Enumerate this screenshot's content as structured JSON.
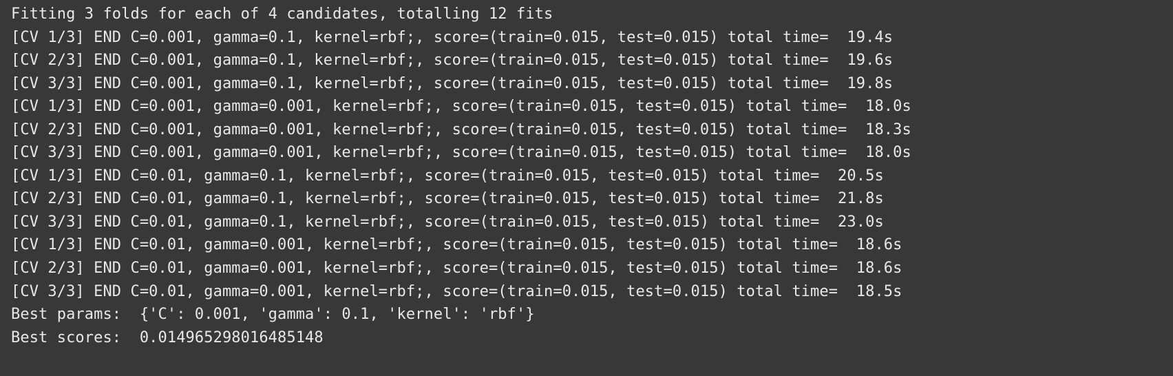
{
  "console": {
    "lines": [
      "Fitting 3 folds for each of 4 candidates, totalling 12 fits",
      "[CV 1/3] END C=0.001, gamma=0.1, kernel=rbf;, score=(train=0.015, test=0.015) total time=  19.4s",
      "[CV 2/3] END C=0.001, gamma=0.1, kernel=rbf;, score=(train=0.015, test=0.015) total time=  19.6s",
      "[CV 3/3] END C=0.001, gamma=0.1, kernel=rbf;, score=(train=0.015, test=0.015) total time=  19.8s",
      "[CV 1/3] END C=0.001, gamma=0.001, kernel=rbf;, score=(train=0.015, test=0.015) total time=  18.0s",
      "[CV 2/3] END C=0.001, gamma=0.001, kernel=rbf;, score=(train=0.015, test=0.015) total time=  18.3s",
      "[CV 3/3] END C=0.001, gamma=0.001, kernel=rbf;, score=(train=0.015, test=0.015) total time=  18.0s",
      "[CV 1/3] END C=0.01, gamma=0.1, kernel=rbf;, score=(train=0.015, test=0.015) total time=  20.5s",
      "[CV 2/3] END C=0.01, gamma=0.1, kernel=rbf;, score=(train=0.015, test=0.015) total time=  21.8s",
      "[CV 3/3] END C=0.01, gamma=0.1, kernel=rbf;, score=(train=0.015, test=0.015) total time=  23.0s",
      "[CV 1/3] END C=0.01, gamma=0.001, kernel=rbf;, score=(train=0.015, test=0.015) total time=  18.6s",
      "[CV 2/3] END C=0.01, gamma=0.001, kernel=rbf;, score=(train=0.015, test=0.015) total time=  18.6s",
      "[CV 3/3] END C=0.01, gamma=0.001, kernel=rbf;, score=(train=0.015, test=0.015) total time=  18.5s",
      "Best params:  {'C': 0.001, 'gamma': 0.1, 'kernel': 'rbf'}",
      "Best scores:  0.014965298016485148"
    ]
  },
  "colors": {
    "background": "#383838",
    "text": "#e8e8e8"
  }
}
